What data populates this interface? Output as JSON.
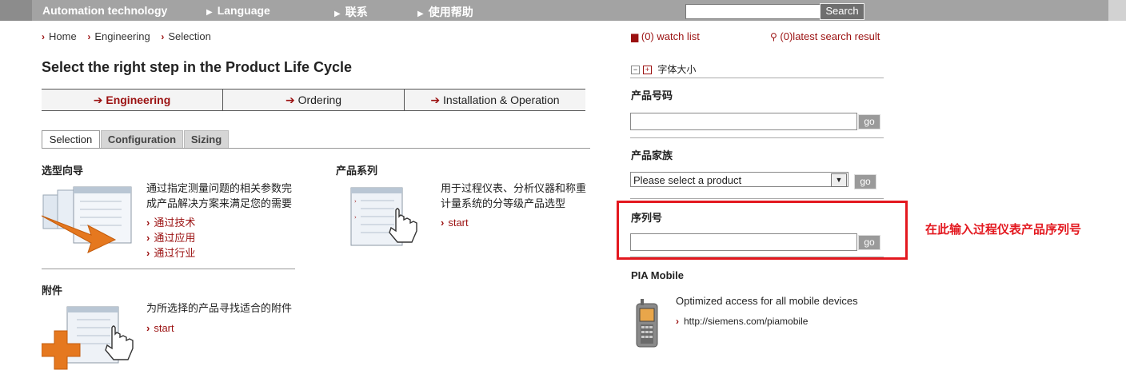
{
  "topnav": {
    "brand": "Automation technology",
    "language": "Language",
    "contact": "联系",
    "help": "使用帮助",
    "search_value": "",
    "search_button": "Search"
  },
  "breadcrumb": [
    "Home",
    "Engineering",
    "Selection"
  ],
  "page_title": "Select the right step in the Product Life Cycle",
  "steps": [
    {
      "label": "Engineering",
      "active": true
    },
    {
      "label": "Ordering",
      "active": false
    },
    {
      "label": "Installation & Operation",
      "active": false
    }
  ],
  "tabs": [
    {
      "label": "Selection",
      "active": true
    },
    {
      "label": "Configuration",
      "active": false
    },
    {
      "label": "Sizing",
      "active": false
    }
  ],
  "sections": {
    "wizard": {
      "title": "选型向导",
      "desc": "通过指定测量问题的相关参数完成产品解决方案来满足您的需要",
      "links": [
        "通过技术",
        "通过应用",
        "通过行业"
      ]
    },
    "series": {
      "title": "产品系列",
      "desc": "用于过程仪表、分析仪器和称重计量系统的分等级产品选型",
      "link": "start"
    },
    "accessories": {
      "title": "附件",
      "desc": "为所选择的产品寻找适合的附件",
      "link": "start"
    }
  },
  "sidebar": {
    "watch_list": "(0) watch list",
    "latest_search": "(0)latest search result",
    "font_size": "字体大小",
    "product_code": {
      "label": "产品号码",
      "value": "",
      "go": "go"
    },
    "product_family": {
      "label": "产品家族",
      "selected": "Please select a product",
      "go": "go"
    },
    "serial_number": {
      "label": "序列号",
      "value": "",
      "go": "go"
    },
    "annotation": "在此输入过程仪表产品序列号",
    "mobile": {
      "title": "PIA Mobile",
      "text": "Optimized access for all mobile devices",
      "link": "http://siemens.com/piamobile"
    }
  }
}
